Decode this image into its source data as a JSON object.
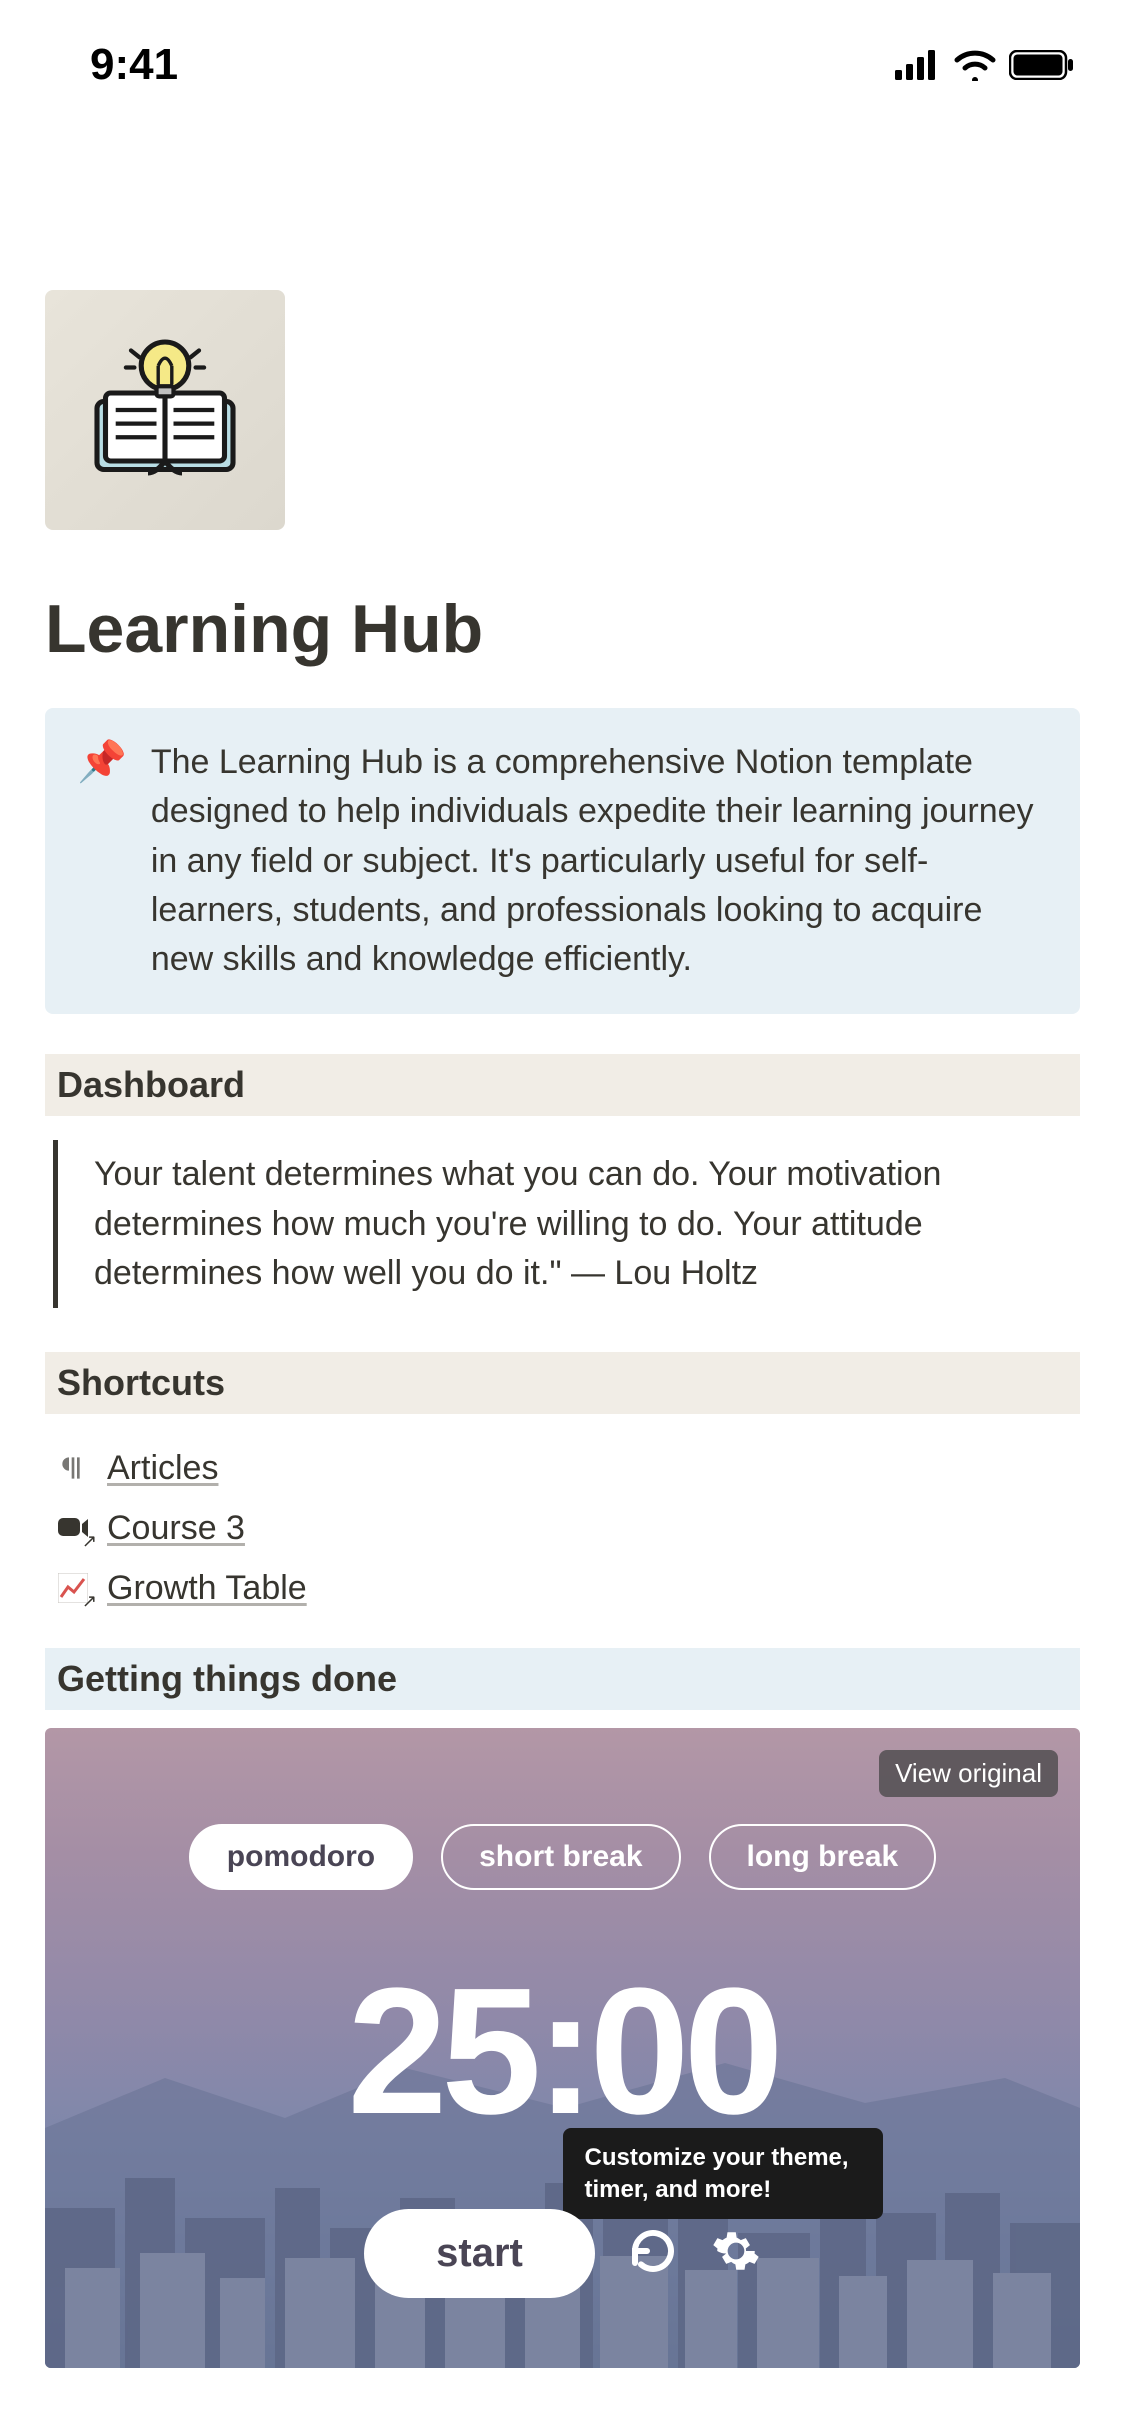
{
  "status": {
    "time": "9:41"
  },
  "page": {
    "title": "Learning Hub"
  },
  "callout": {
    "icon": "📌",
    "text": "The Learning Hub is a comprehensive Notion template designed to help individuals expedite their learning journey in any field or subject. It's particularly useful for self-learners, students, and professionals looking to acquire new skills and knowledge efficiently."
  },
  "sections": {
    "dashboard": "Dashboard",
    "shortcuts": "Shortcuts",
    "gtd": "Getting things done"
  },
  "quote": "Your talent determines what you can do. Your motivation determines how much you're willing to do. Your attitude determines how well you do it.\" — Lou Holtz",
  "shortcuts": [
    {
      "icon": "paragraph",
      "label": "Articles"
    },
    {
      "icon": "video",
      "label": "Course 3"
    },
    {
      "icon": "chart",
      "label": "Growth Table"
    }
  ],
  "pomodoro": {
    "view_original": "View original",
    "tabs": {
      "pomodoro": "pomodoro",
      "short_break": "short break",
      "long_break": "long break"
    },
    "timer": "25:00",
    "tooltip": "Customize your theme, timer, and more!",
    "start": "start"
  }
}
